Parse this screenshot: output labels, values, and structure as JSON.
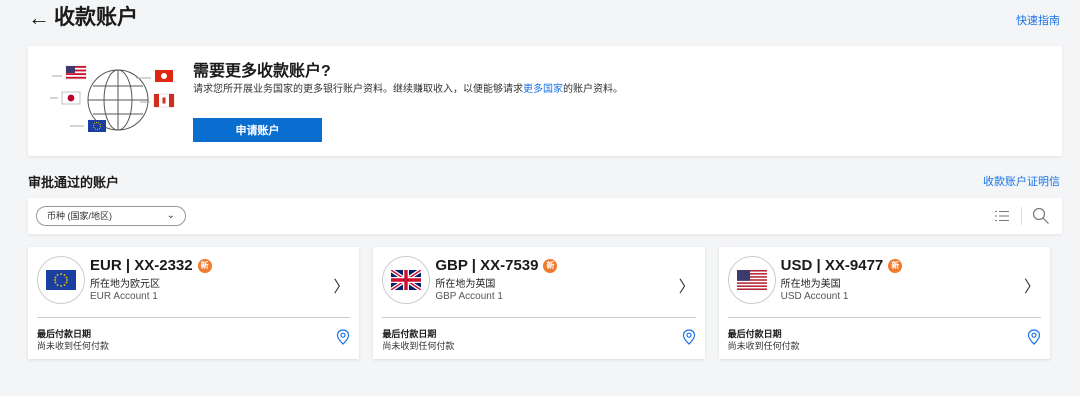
{
  "header": {
    "back_icon": "←",
    "title": "收款账户",
    "guide_link": "快速指南"
  },
  "promo": {
    "title": "需要更多收款账户?",
    "desc_before": "请求您所开展业务国家的更多银行账户资料。继续赚取收入，以便能够请求",
    "desc_link": "更多国家",
    "desc_after": "的账户资料。",
    "button": "申请账户",
    "illustration_icon": "globe-with-flags-illustration"
  },
  "approved": {
    "section_title": "审批通过的账户",
    "cert_link": "收款账户证明信"
  },
  "filter": {
    "currency_select": "币种 (国家/地区)",
    "chevron_icon": "chevron-down-icon",
    "list_icon": "list-icon",
    "search_icon": "search-icon"
  },
  "accounts": [
    {
      "currency": "EUR",
      "number": "XX-2332",
      "badge": "新",
      "location": "所在地为欧元区",
      "name": "EUR Account 1",
      "flag_icon": "eu-flag-icon",
      "last_payment_label": "最后付款日期",
      "last_payment_value": "尚未收到任何付款"
    },
    {
      "currency": "GBP",
      "number": "XX-7539",
      "badge": "新",
      "location": "所在地为英国",
      "name": "GBP Account 1",
      "flag_icon": "uk-flag-icon",
      "last_payment_label": "最后付款日期",
      "last_payment_value": "尚未收到任何付款"
    },
    {
      "currency": "USD",
      "number": "XX-9477",
      "badge": "新",
      "location": "所在地为美国",
      "name": "USD Account 1",
      "flag_icon": "us-flag-icon",
      "last_payment_label": "最后付款日期",
      "last_payment_value": "尚未收到任何付款"
    }
  ],
  "colors": {
    "accent": "#1a73e8",
    "button": "#0a6ed1",
    "badge": "#f07a2e"
  }
}
